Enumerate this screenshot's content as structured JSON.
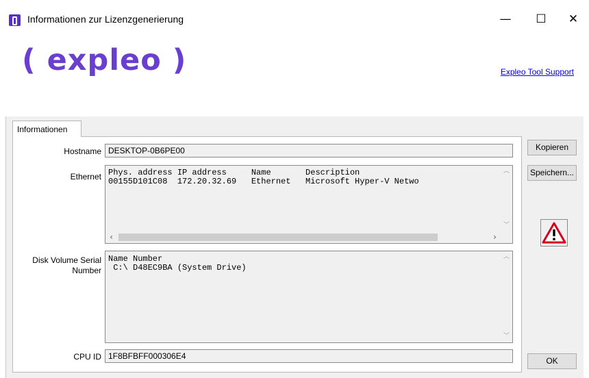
{
  "window": {
    "title": "Informationen zur Lizenzgenerierung",
    "minimize_glyph": "—",
    "maximize_glyph": "☐",
    "close_glyph": "✕"
  },
  "header": {
    "logo_text": "expleo",
    "logo_color": "#6a3fd0",
    "support_link": "Expleo Tool Support"
  },
  "tabs": [
    {
      "label": "Informationen"
    }
  ],
  "fields": {
    "hostname": {
      "label": "Hostname",
      "value": "DESKTOP-0B6PE00"
    },
    "ethernet": {
      "label": "Ethernet",
      "lines": [
        "Phys. address IP address     Name       Description",
        "00155D101C08  172.20.32.69   Ethernet   Microsoft Hyper-V Netwo"
      ]
    },
    "disk": {
      "label_line1": "Disk Volume Serial",
      "label_line2": "Number",
      "lines": [
        "Name Number",
        " C:\\ D48EC9BA (System Drive)"
      ]
    },
    "cpu": {
      "label": "CPU ID",
      "value": "1F8BFBFF000306E4"
    }
  },
  "buttons": {
    "copy": "Kopieren",
    "save": "Speichern...",
    "ok": "OK"
  },
  "icons": {
    "warning": "warning-icon",
    "app": "expleo-app-icon"
  }
}
